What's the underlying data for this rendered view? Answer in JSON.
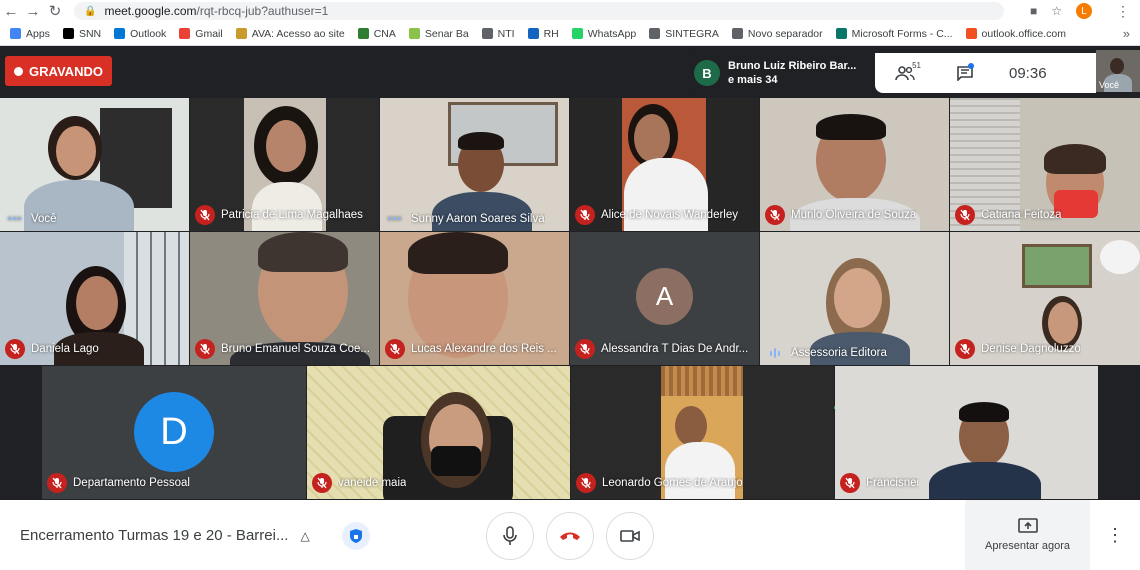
{
  "browser": {
    "url_host": "meet.google.com",
    "url_path": "/rqt-rbcq-jub?authuser=1",
    "profile_initial": "L",
    "bookmarks": [
      {
        "label": "Apps",
        "color": "#4285f4"
      },
      {
        "label": "SNN",
        "color": "#000000"
      },
      {
        "label": "Outlook",
        "color": "#0078d4"
      },
      {
        "label": "Gmail",
        "color": "#ea4335"
      },
      {
        "label": "AVA: Acesso ao site",
        "color": "#c99a2e"
      },
      {
        "label": "CNA",
        "color": "#2e7d32"
      },
      {
        "label": "Senar Ba",
        "color": "#8bc34a"
      },
      {
        "label": "NTI",
        "color": "#5f6368"
      },
      {
        "label": "RH",
        "color": "#1565c0"
      },
      {
        "label": "WhatsApp",
        "color": "#25d366"
      },
      {
        "label": "SINTEGRA",
        "color": "#5f6368"
      },
      {
        "label": "Novo separador",
        "color": "#5f6368"
      },
      {
        "label": "Microsoft Forms - C...",
        "color": "#077568"
      },
      {
        "label": "outlook.office.com",
        "color": "#f25022"
      }
    ]
  },
  "meet": {
    "recording_label": "GRAVANDO",
    "presenter": {
      "initial": "B",
      "line1": "Bruno Luiz Ribeiro Bar...",
      "line2": "e mais 34"
    },
    "participant_count": "51",
    "time": "09:36",
    "self_label": "Você",
    "tiles": [
      {
        "name": "Você",
        "indicator": "dots"
      },
      {
        "name": "Patricia de Lima Magalhaes",
        "indicator": "muted"
      },
      {
        "name": "Sunny Aaron Soares Silva",
        "indicator": "dots"
      },
      {
        "name": "Alice de Novais Wanderley",
        "indicator": "muted"
      },
      {
        "name": "Murilo Oliveira de Souza",
        "indicator": "muted"
      },
      {
        "name": "Catiana Feitoza",
        "indicator": "muted"
      },
      {
        "name": "Daniela Lago",
        "indicator": "muted"
      },
      {
        "name": "Bruno Emanuel Souza Coe...",
        "indicator": "muted"
      },
      {
        "name": "Lucas Alexandre dos Reis ...",
        "indicator": "muted"
      },
      {
        "name": "Alessandra T Dias De Andr...",
        "indicator": "muted",
        "avatar": "A"
      },
      {
        "name": "Assessoria Editora",
        "indicator": "speaking"
      },
      {
        "name": "Denise Dagnoluzzo",
        "indicator": "muted"
      },
      {
        "name": "Departamento Pessoal",
        "indicator": "muted",
        "avatar": "D"
      },
      {
        "name": "vaneide maia",
        "indicator": "muted"
      },
      {
        "name": "Leonardo Gomes de Araujo",
        "indicator": "muted"
      },
      {
        "name": "Francisnei",
        "indicator": "muted"
      }
    ]
  },
  "bottom": {
    "meeting_title": "Encerramento Turmas 19 e 20 - Barrei...",
    "present_label": "Apresentar agora"
  },
  "colors": {
    "accent_red": "#d93025",
    "muted_red": "#c5221f",
    "speaking_green": "#1ea362",
    "avatar_a": "#8d6e63",
    "avatar_d": "#1e88e5"
  }
}
